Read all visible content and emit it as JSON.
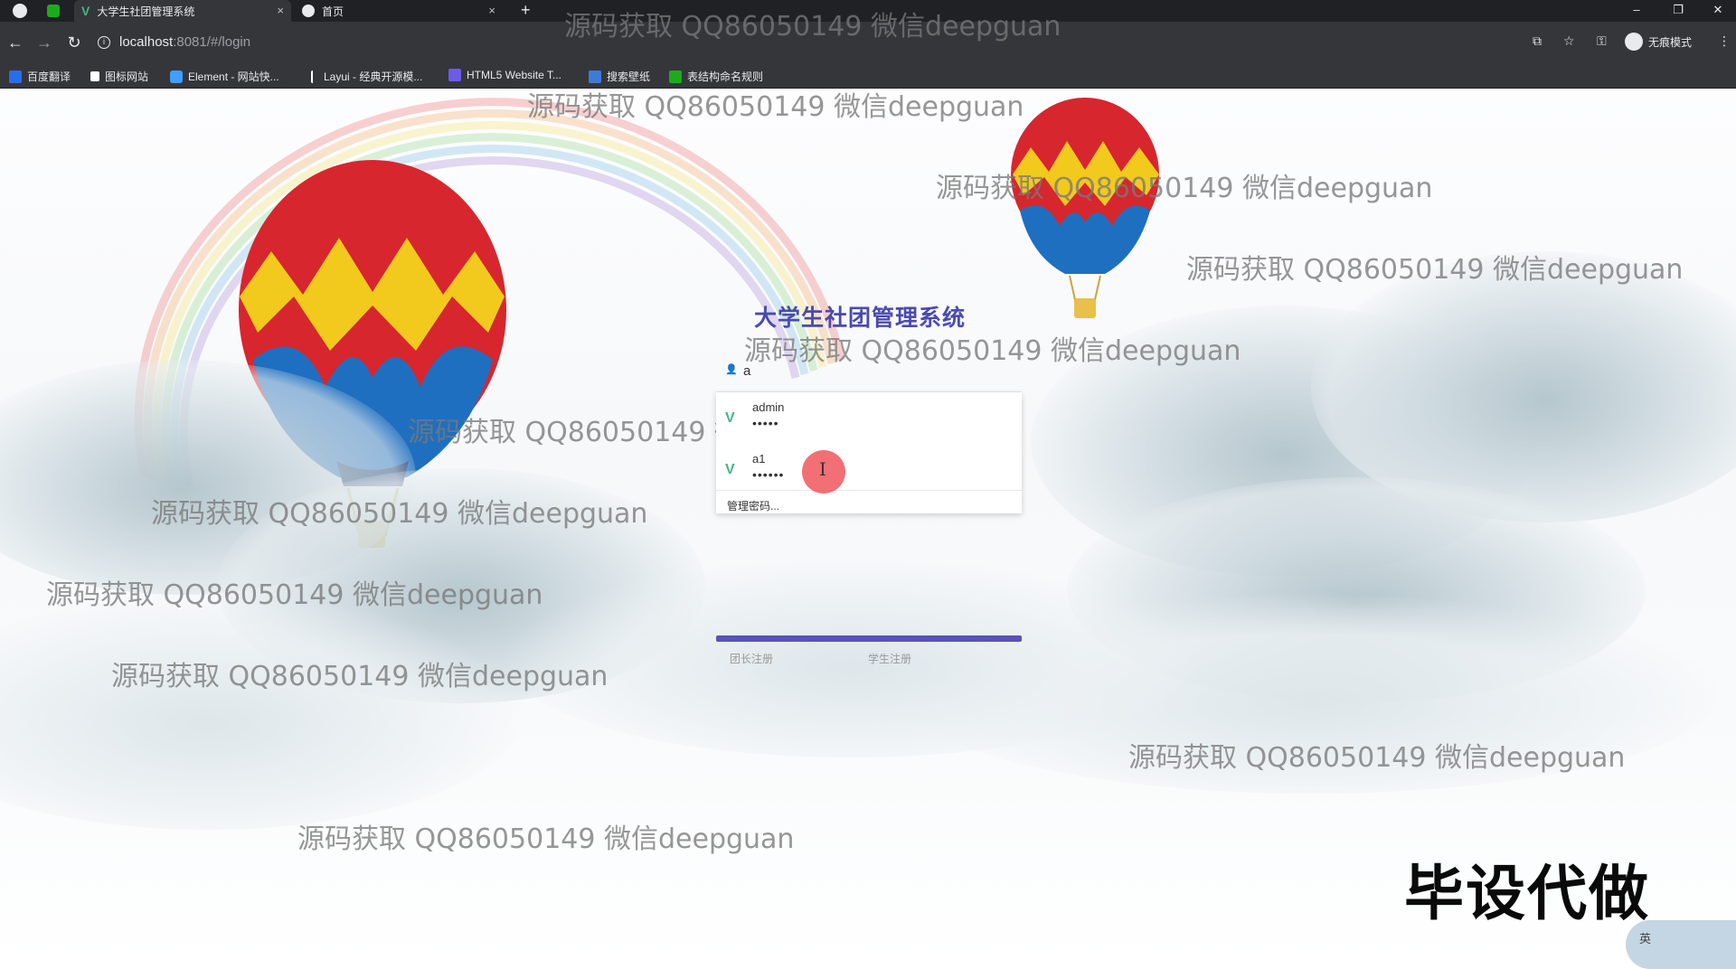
{
  "browser": {
    "tabs": [
      {
        "label": "大学生社团管理系统",
        "active": true
      },
      {
        "label": "首页",
        "active": false
      }
    ],
    "new_tab_label": "+",
    "close_glyph": "×",
    "url_host": "localhost",
    "url_path": ":8081/#/login",
    "profile_label": "无痕模式",
    "bookmarks": [
      {
        "label": "百度翻译",
        "color": "#2a6cf0"
      },
      {
        "label": "图标网站",
        "color": "#ffffff"
      },
      {
        "label": "Element - 网站快...",
        "color": "#409eff"
      },
      {
        "label": "Layui - 经典开源模...",
        "color": "#ffffff"
      },
      {
        "label": "HTML5 Website T...",
        "color": "#6b5ce7"
      },
      {
        "label": "搜索壁纸",
        "color": "#3d7bd9"
      },
      {
        "label": "表结构命名规则",
        "color": "#1aad19"
      }
    ]
  },
  "watermark_text": "源码获取 QQ86050149 微信deepguan",
  "login": {
    "system_title": "大学生社团管理系统",
    "username_value": "a",
    "autofill": [
      {
        "username": "admin",
        "password_mask": "•••••"
      },
      {
        "username": "a1",
        "password_mask": "••••••"
      }
    ],
    "manage_passwords": "管理密码...",
    "register_leader": "团长注册",
    "register_student": "学生注册"
  },
  "overlay": {
    "caption": "毕设代做",
    "ime_label": "英"
  },
  "colors": {
    "accent": "#5a52b6",
    "title": "#4a4ab0",
    "autofill_icon": "#41b883"
  }
}
